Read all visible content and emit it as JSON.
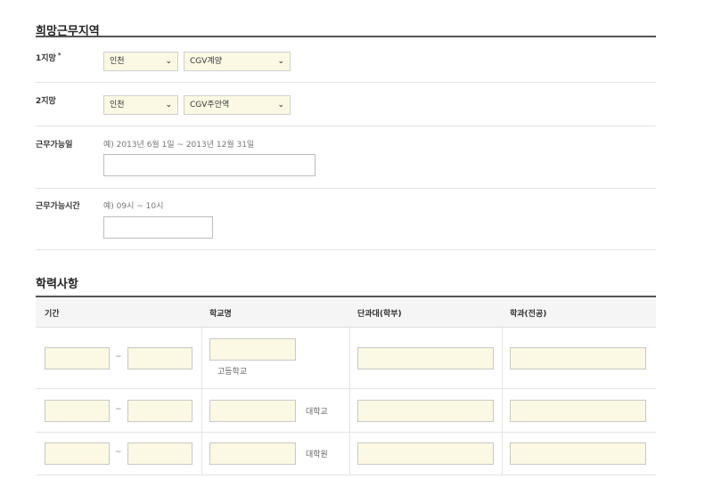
{
  "work_region": {
    "title": "희망근무지역",
    "choice1": {
      "label": "1지망",
      "required_mark": "*",
      "region": "인천",
      "branch": "CGV계양"
    },
    "choice2": {
      "label": "2지망",
      "region": "인천",
      "branch": "CGV주안역"
    },
    "available_date": {
      "label": "근무가능일",
      "hint": "예) 2013년 6월 1일 ~ 2013년 12월 31일",
      "value": ""
    },
    "available_time": {
      "label": "근무가능시간",
      "hint": "예) 09시 ~ 10시",
      "value": ""
    }
  },
  "education": {
    "title": "학력사항",
    "headers": [
      "기간",
      "학교명",
      "단과대(학부)",
      "학과(전공)"
    ],
    "tilde": "~",
    "rows": [
      {
        "school_suffix": "고등학교"
      },
      {
        "school_suffix": "대학교"
      },
      {
        "school_suffix": "대학원"
      }
    ]
  },
  "icons": {
    "dropdown": "chevron-down-icon"
  },
  "colors": {
    "field_bg": "#fbf8e4",
    "rule_dark": "#555555",
    "header_bg": "#f5f5f5"
  }
}
